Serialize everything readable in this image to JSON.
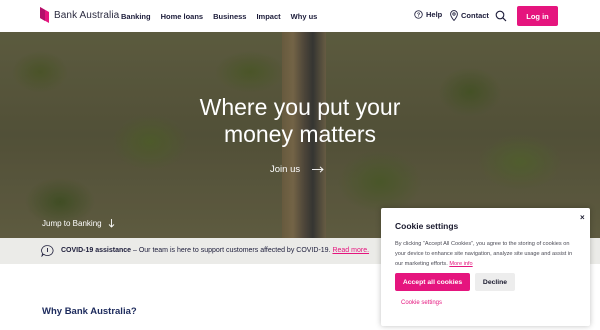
{
  "header": {
    "brand": "Bank Australia",
    "nav": [
      "Banking",
      "Home loans",
      "Business",
      "Impact",
      "Why us"
    ],
    "help_label": "Help",
    "contact_label": "Contact",
    "login_label": "Log in"
  },
  "hero": {
    "title_line1": "Where you put your",
    "title_line2": "money matters",
    "cta_label": "Join us",
    "jump_label": "Jump to Banking"
  },
  "notice": {
    "bold": "COVID-19 assistance",
    "text": " – Our team is here to support customers affected by COVID-19. ",
    "link": "Read more."
  },
  "section": {
    "heading": "Why Bank Australia?"
  },
  "cookie": {
    "title": "Cookie settings",
    "close": "×",
    "body": "By clicking “Accept All Cookies”, you agree to the storing of cookies on your device to enhance site navigation, analyze site usage and assist in our marketing efforts. ",
    "more_info": "More info",
    "accept_label": "Accept all cookies",
    "decline_label": "Decline",
    "settings_label": "Cookie settings"
  },
  "colors": {
    "brand_pink": "#e5157e",
    "navy": "#1c2a5c",
    "notice_bg": "#ebebe8"
  }
}
